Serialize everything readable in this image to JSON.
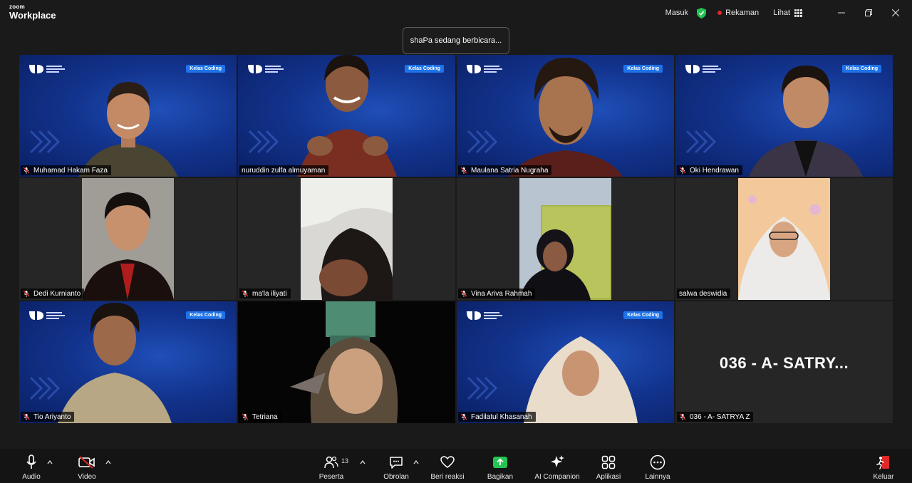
{
  "app": {
    "logo_top": "zoom",
    "logo_bottom": "Workplace"
  },
  "titlebar": {
    "sign_in": "Masuk",
    "recording": "Rekaman",
    "view": "Lihat"
  },
  "toast": {
    "text": "shaPa sedang berbicara..."
  },
  "brand": {
    "badge": "Kelas Coding"
  },
  "participants": [
    {
      "name": "Muhamad Hakam Faza",
      "style": "blue"
    },
    {
      "name": "nuruddin zulfa almuyaman",
      "style": "blue"
    },
    {
      "name": "Maulana Satria Nugraha",
      "style": "blue"
    },
    {
      "name": "Oki Hendrawan",
      "style": "blue"
    },
    {
      "name": "Dedi Kurnianto",
      "style": "camera"
    },
    {
      "name": "ma'la iliyati",
      "style": "camera"
    },
    {
      "name": "Vina Ariva Rahmah",
      "style": "camera"
    },
    {
      "name": "salwa deswidia",
      "style": "camera"
    },
    {
      "name": "Tio Ariyanto",
      "style": "blue"
    },
    {
      "name": "Tetriana",
      "style": "dark"
    },
    {
      "name": "Fadilatul Khasanah",
      "style": "blue"
    },
    {
      "name": "036 - A- SATRYA Z",
      "display": "036 - A- SATRY...",
      "style": "avatar"
    }
  ],
  "toolbar": {
    "audio": "Audio",
    "video": "Video",
    "participants": "Peserta",
    "participants_count": "13",
    "chat": "Obrolan",
    "react": "Beri reaksi",
    "share": "Bagikan",
    "ai": "AI Companion",
    "apps": "Aplikasi",
    "more": "Lainnya",
    "leave": "Keluar"
  },
  "colors": {
    "accent": "#1e73e8",
    "share_green": "#23c552",
    "leave_red": "#e02828",
    "recording_dot": "#e02828"
  }
}
